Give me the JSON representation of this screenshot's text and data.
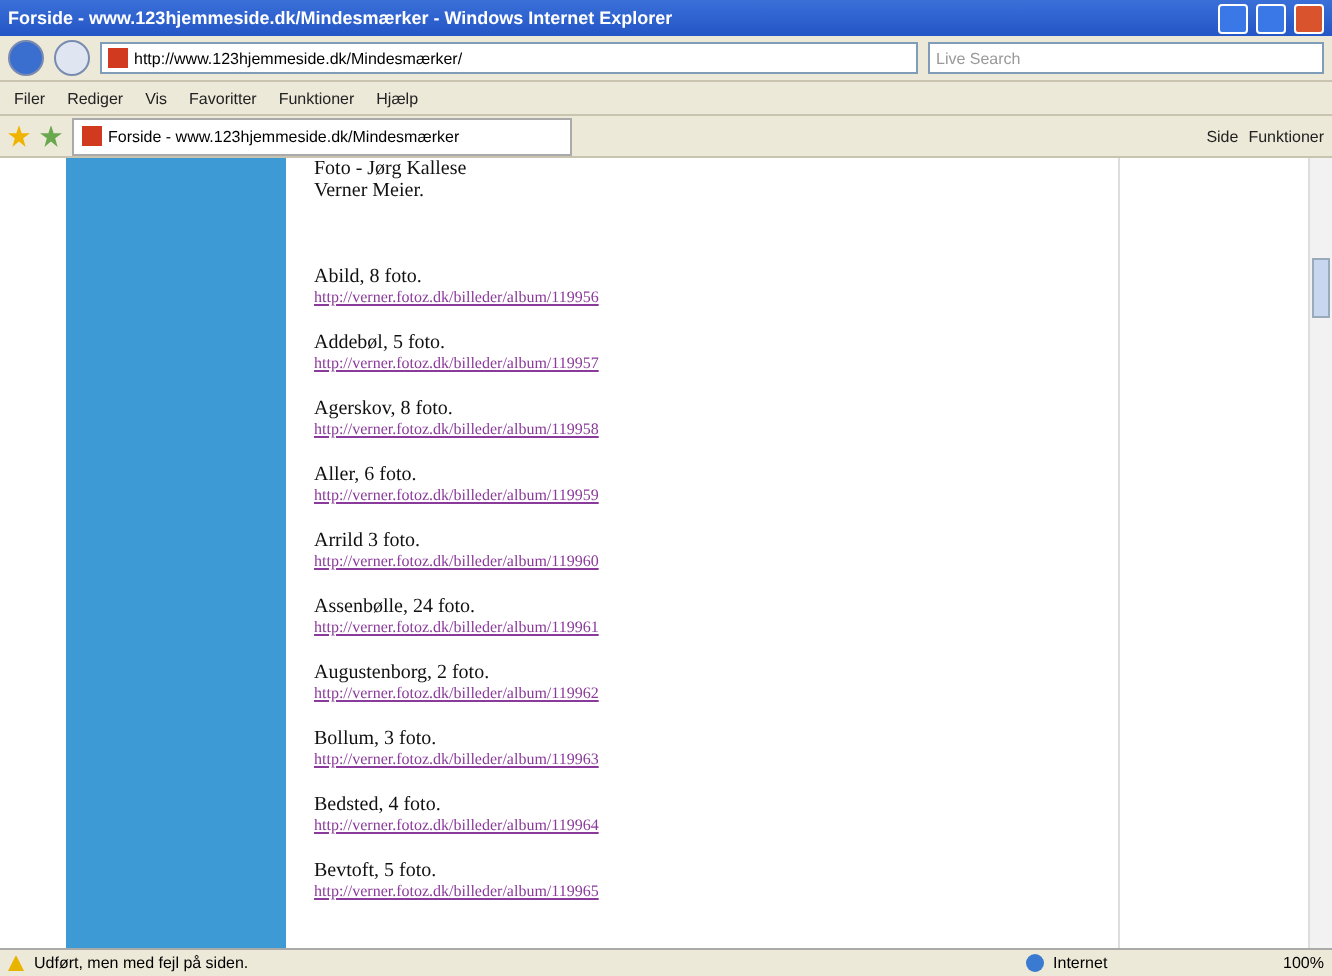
{
  "window": {
    "title": "Forside - www.123hjemmeside.dk/Mindesmærker - Windows Internet Explorer"
  },
  "address": {
    "url": "http://www.123hjemmeside.dk/Mindesmærker/",
    "search_placeholder": "Live Search"
  },
  "menu": [
    "Filer",
    "Rediger",
    "Vis",
    "Favoritter",
    "Funktioner",
    "Hjælp"
  ],
  "tab": {
    "label": "Forside - www.123hjemmeside.dk/Mindesmærker"
  },
  "command_bar": [
    {
      "label": "Side"
    },
    {
      "label": "Funktioner"
    }
  ],
  "page": {
    "intro": [
      "Foto - Jørg Kallese",
      "Verner Meier."
    ],
    "entries": [
      {
        "title": "Abild,  8 foto.",
        "link": "http://verner.fotoz.dk/billeder/album/119956"
      },
      {
        "title": "Addebøl,  5 foto.",
        "link": "http://verner.fotoz.dk/billeder/album/119957"
      },
      {
        "title": "Agerskov,  8 foto.",
        "link": "http://verner.fotoz.dk/billeder/album/119958"
      },
      {
        "title": " Aller,  6 foto.",
        "link": "http://verner.fotoz.dk/billeder/album/119959"
      },
      {
        "title": "Arrild  3 foto.",
        "link": "http://verner.fotoz.dk/billeder/album/119960"
      },
      {
        "title": "Assenbølle,  24 foto.",
        "link": "http://verner.fotoz.dk/billeder/album/119961"
      },
      {
        "title": "Augustenborg,  2 foto.",
        "link": "http://verner.fotoz.dk/billeder/album/119962"
      },
      {
        "title": "Bollum,  3 foto.",
        "link": "http://verner.fotoz.dk/billeder/album/119963"
      },
      {
        "title": "Bedsted,  4 foto.",
        "link": "http://verner.fotoz.dk/billeder/album/119964"
      },
      {
        "title": "Bevtoft,  5 foto.",
        "link": "http://verner.fotoz.dk/billeder/album/119965"
      }
    ]
  },
  "status_bar": {
    "message": "Udført, men med fejl på siden.",
    "zone": "Internet",
    "zoom": "100%"
  }
}
